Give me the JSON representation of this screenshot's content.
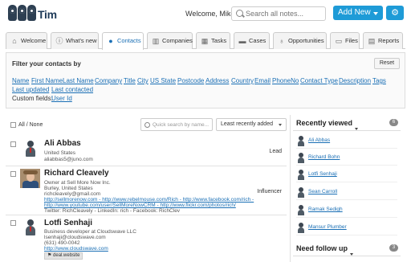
{
  "header": {
    "brand": "Tim",
    "welcome": "Welcome, Mike",
    "search_placeholder": "Search all notes...",
    "add_new_label": "Add New",
    "gear_icon": "gear-icon"
  },
  "tabs": [
    {
      "label": "Welcome",
      "icon": "home-icon",
      "active": false
    },
    {
      "label": "What's new",
      "icon": "info-icon",
      "active": false
    },
    {
      "label": "Contacts",
      "icon": "user-icon",
      "active": true
    },
    {
      "label": "Companies",
      "icon": "building-icon",
      "active": false
    },
    {
      "label": "Tasks",
      "icon": "calendar-icon",
      "active": false
    },
    {
      "label": "Cases",
      "icon": "briefcase-icon",
      "active": false
    },
    {
      "label": "Opportunities",
      "icon": "lightbulb-icon",
      "active": false
    },
    {
      "label": "Files",
      "icon": "folder-icon",
      "active": false
    },
    {
      "label": "Reports",
      "icon": "chart-icon",
      "active": false
    }
  ],
  "filter": {
    "title": "Filter your contacts by",
    "reset_label": "Reset",
    "fields": [
      "Name",
      "First Name",
      "Last Name",
      "Company",
      "Title",
      "City",
      "US State",
      "Postcode",
      "Address",
      "Country",
      "Email",
      "PhoneNo",
      "Contact Type",
      "Description",
      "Tags",
      "Last updated",
      "Last contacted"
    ],
    "custom_fields_label": "Custom fields:",
    "custom_fields": [
      "User Id"
    ]
  },
  "list": {
    "all_none_label": "All / None",
    "quick_search_placeholder": "Quick search by name...",
    "sort_value": "Least recently added"
  },
  "contacts": [
    {
      "name": "Ali Abbas",
      "lines": [
        "United States",
        "aliabbas5@juno.com"
      ],
      "role": "Lead",
      "avatar": "person-icon"
    },
    {
      "name": "Richard Cleavely",
      "lines": [
        "Owner at Sell More Now Inc.",
        "Burley, United States",
        "richcleavely@gmail.com",
        "http://sellmorenow.com - http://www.rebelmouse.com/Rich - http://www.facebook.com/rich -",
        "http://www.youtube.com/user/SellMoreNowCRM - http://www.flickr.com/photos/rich/",
        "Twitter: RichCleavely - LinkedIn: rich - Facebook: RichClev"
      ],
      "role": "Influencer",
      "avatar": "photo"
    },
    {
      "name": "Lotfi Senhaji",
      "lines": [
        "Business developer at Cloudswave LLC",
        "lsenhaji@cloudswave.com",
        "(631) 490-0042",
        "http://www.cloudswave.com"
      ],
      "role": "",
      "tag": "deal.website",
      "avatar": "person-icon"
    }
  ],
  "recently_viewed": {
    "title": "Recently viewed",
    "count": "6",
    "items": [
      "Ali Abbas",
      "Richard Bohn",
      "Lotfi Senhaji",
      "Sean Carroll",
      "Ramak Sedigh",
      "Mansur Plumber"
    ]
  },
  "need_follow_up": {
    "title": "Need follow up",
    "count": "3"
  }
}
